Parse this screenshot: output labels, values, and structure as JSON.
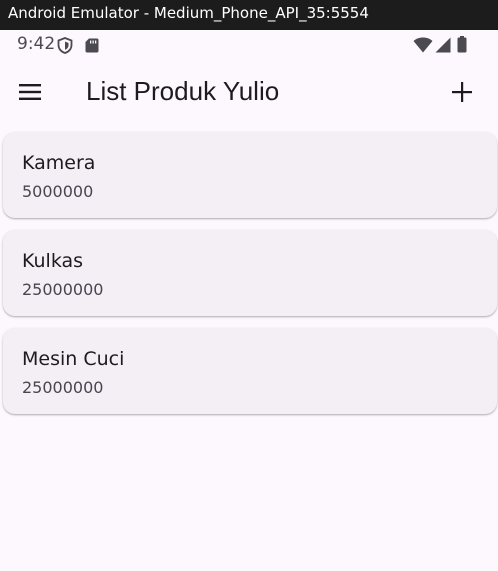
{
  "window": {
    "title": "Android Emulator - Medium_Phone_API_35:5554"
  },
  "status_bar": {
    "time": "9:42",
    "icons": [
      "shield-icon",
      "sd-card-icon",
      "wifi-icon",
      "signal-icon",
      "battery-icon"
    ]
  },
  "app_bar": {
    "title": "List Produk Yulio",
    "leading_icon": "menu-icon",
    "trailing_icon": "add-icon"
  },
  "products": [
    {
      "name": "Kamera",
      "price": "5000000"
    },
    {
      "name": "Kulkas",
      "price": "25000000"
    },
    {
      "name": "Mesin Cuci",
      "price": "25000000"
    }
  ],
  "colors": {
    "background": "#fdf7fe",
    "card": "#f4eff5",
    "text_primary": "#1d1b20",
    "text_secondary": "#49454f",
    "window_titlebar": "#1c1c1c"
  }
}
